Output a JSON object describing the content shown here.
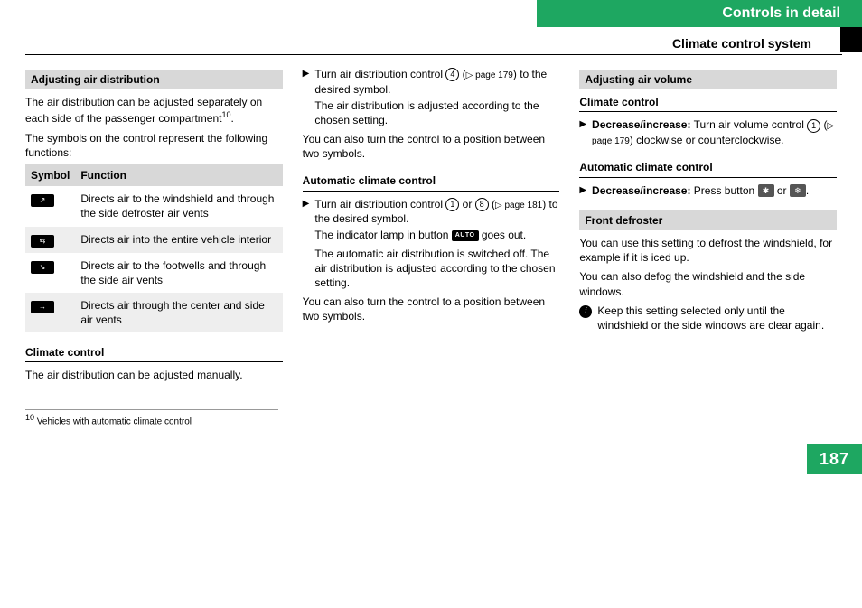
{
  "header": {
    "chapter": "Controls in detail",
    "section": "Climate control system",
    "page_number": "187"
  },
  "col1": {
    "title_air_dist": "Adjusting air distribution",
    "p1a": "The air distribution can be adjusted separately on each side of the passenger compartment",
    "p1_fn": "10",
    "p1b": ".",
    "p2": "The symbols on the control represent the following functions:",
    "table_header_symbol": "Symbol",
    "table_header_function": "Function",
    "table_rows": [
      {
        "func": "Directs air to the windshield and through the side defroster air vents"
      },
      {
        "func": "Directs air into the entire vehicle interior"
      },
      {
        "func": "Directs air to the footwells and through the side air vents"
      },
      {
        "func": "Directs air through the center and side air vents"
      }
    ],
    "subhead_cc": "Climate control",
    "p3": "The air distribution can be adjusted manually.",
    "footnote_num": "10",
    "footnote_text": " Vehicles with automatic climate control"
  },
  "col2": {
    "b1_a": "Turn air distribution control ",
    "b1_num": "4",
    "b1_b": " (",
    "b1_pageref": "▷ page 179",
    "b1_c": ") to the desired symbol.",
    "b1_line2": "The air distribution is adjusted according to the chosen setting.",
    "p1": "You can also turn the control to a position between two symbols.",
    "subhead_acc": "Automatic climate control",
    "b2_a": "Turn air distribution control ",
    "b2_num1": "1",
    "b2_or": " or ",
    "b2_num2": "8",
    "b2_b": " (",
    "b2_pageref": "▷ page 181",
    "b2_c": ") to the desired symbol.",
    "b2_line2a": "The indicator lamp in button ",
    "b2_badge": "AUTO",
    "b2_line2b": " goes out.",
    "b2_line3": "The automatic air distribution is switched off. The air distribution is adjusted according to the chosen setting.",
    "p2": "You can also turn the control to a position between two symbols."
  },
  "col3": {
    "title_air_vol": "Adjusting air volume",
    "subhead_cc": "Climate control",
    "b1_label": "Decrease/increase:",
    "b1_a": " Turn air volume control ",
    "b1_num": "1",
    "b1_b": " (",
    "b1_pageref": "▷ page 179",
    "b1_c": ") clockwise or counterclockwise.",
    "subhead_acc": "Automatic climate control",
    "b2_label": "Decrease/increase:",
    "b2_a": " Press button ",
    "b2_icon1": "✱",
    "b2_or": " or ",
    "b2_icon2": "❄",
    "b2_c": ".",
    "title_front_def": "Front defroster",
    "p1": "You can use this setting to defrost the windshield, for example if it is iced up.",
    "p2": "You can also defog the windshield and the side windows.",
    "info_text": "Keep this setting selected only until the windshield or the side windows are clear again."
  }
}
